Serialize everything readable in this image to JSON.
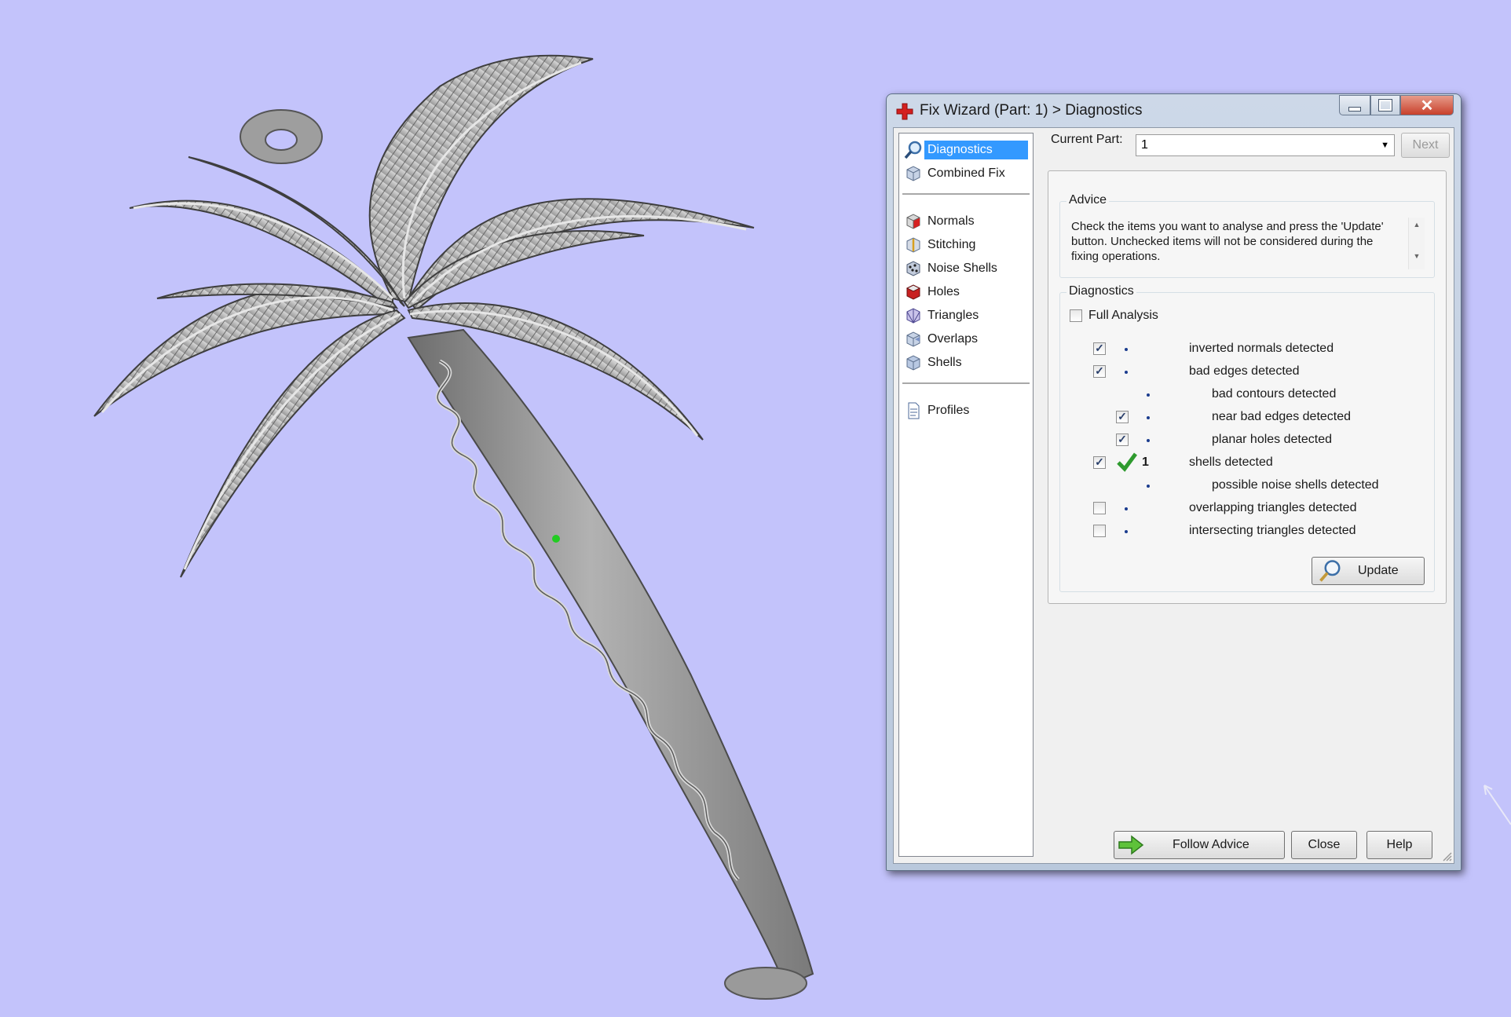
{
  "dialog": {
    "title": "Fix Wizard (Part: 1) > Diagnostics",
    "close_glyph": "✕"
  },
  "nav": {
    "items": [
      {
        "label": "Diagnostics",
        "icon": "magnifier-icon",
        "selected": true
      },
      {
        "label": "Combined Fix",
        "icon": "cube-icon"
      },
      {
        "label": "Normals",
        "icon": "normals-cube-icon"
      },
      {
        "label": "Stitching",
        "icon": "stitching-cube-icon"
      },
      {
        "label": "Noise Shells",
        "icon": "noise-shells-icon"
      },
      {
        "label": "Holes",
        "icon": "holes-cube-icon"
      },
      {
        "label": "Triangles",
        "icon": "triangles-cube-icon"
      },
      {
        "label": "Overlaps",
        "icon": "overlaps-cube-icon"
      },
      {
        "label": "Shells",
        "icon": "shells-cube-icon"
      },
      {
        "label": "Profiles",
        "icon": "profile-document-icon"
      }
    ]
  },
  "current_part": {
    "label": "Current Part:",
    "value": "1",
    "next_label": "Next"
  },
  "advice": {
    "title": "Advice",
    "text": "Check the items you want to analyse and press the 'Update' button. Unchecked items will not be considered during the fixing operations."
  },
  "diagnostics": {
    "title": "Diagnostics",
    "full_analysis": {
      "label": "Full Analysis",
      "checked": false
    },
    "rows": [
      {
        "label": "inverted normals detected",
        "checked": true,
        "indent": 0
      },
      {
        "label": "bad edges detected",
        "checked": true,
        "indent": 0
      },
      {
        "label": "bad contours detected",
        "checked": null,
        "indent": 1
      },
      {
        "label": "near bad edges detected",
        "checked": true,
        "indent": 1
      },
      {
        "label": "planar holes detected",
        "checked": true,
        "indent": 1
      },
      {
        "label": "shells detected",
        "checked": true,
        "indent": 0,
        "status": "ok",
        "count": "1"
      },
      {
        "label": "possible noise shells detected",
        "checked": null,
        "indent": 1
      },
      {
        "label": "overlapping triangles detected",
        "checked": false,
        "indent": 0
      },
      {
        "label": "intersecting triangles detected",
        "checked": false,
        "indent": 0
      }
    ],
    "update_label": "Update"
  },
  "footer": {
    "follow_advice_label": "Follow Advice",
    "close_label": "Close",
    "help_label": "Help"
  },
  "colors": {
    "background": "#c3c3fb",
    "model_gray": "#8a8a8a",
    "selection": "#3399ff",
    "checkmark_green": "#2e9a2e"
  }
}
